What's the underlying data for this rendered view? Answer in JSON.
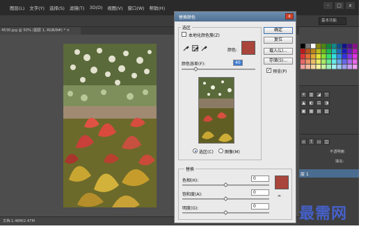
{
  "menubar": {
    "items": [
      "图层(L)",
      "文字(Y)",
      "选择(S)",
      "滤镜(T)",
      "3D(D)",
      "视图(V)",
      "窗口(W)",
      "帮助(H)"
    ],
    "window_buttons": [
      "-",
      "□",
      "x"
    ]
  },
  "options_bar": {
    "workspace": "基本功能"
  },
  "document": {
    "tab_label": "4530.jpg @ 50% (图层 1, RGB/8#) * ×",
    "status": "文档:1.46M/2.47M"
  },
  "panels": {
    "opacity_label": "不透明度:",
    "fill_label": "填充:",
    "layer_name": "层 1"
  },
  "dialog": {
    "title": "替换颜色",
    "close_glyph": "x",
    "selection_group": "选区",
    "localized_clusters_label": "本地化颜色簇(Z)",
    "color_label": "颜色:",
    "color_swatch": "#a9453b",
    "fuzziness_label": "颜色容差(F):",
    "fuzziness_value": "40",
    "fuzziness_fraction": 0.2,
    "radio_selection": "选区(C)",
    "radio_image": "图像(M)",
    "replacement_group": "替换",
    "hue_label": "色相(H):",
    "hue_value": "0",
    "saturation_label": "饱和度(A):",
    "saturation_value": "0",
    "lightness_label": "明度(G):",
    "lightness_value": "0",
    "result_swatch": "#a9453b",
    "buttons": {
      "ok": "确定",
      "reset": "复位",
      "load": "载入(L)...",
      "save": "存储(S)..."
    },
    "preview_label": "预览(P)",
    "preview_checked": true
  },
  "watermark": "最需网",
  "icons": {
    "eyedropper": "eyedropper-icon",
    "eyedropper_add": "eyedropper-plus-icon",
    "eyedropper_subtract": "eyedropper-minus-icon",
    "check": "checkmark-icon"
  },
  "colors": {
    "app_bg": "#535353",
    "menubar_bg": "#2a2a2a",
    "dialog_bg": "#eaeaea",
    "title_bar": "#5b7ea3",
    "watermark": "#4560c9"
  }
}
